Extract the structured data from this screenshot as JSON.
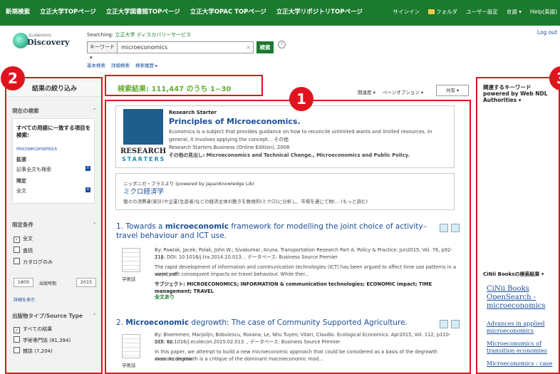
{
  "topbar": {
    "links": [
      "新規検索",
      "立正大学TOPページ",
      "立正大学図書館TOPページ",
      "立正大学OPAC TOPページ",
      "立正大学リポジトリTOPページ"
    ],
    "sign_in": "サインイン",
    "folder": "フォルダ",
    "user_settings": "ユーザー設定",
    "language": "言語 ▾",
    "help": "Help(英語)"
  },
  "header": {
    "logo_small": "国立情報学研究所",
    "logo_word": "Discovery",
    "searching_label": "Searching:",
    "searching_value": "立正大学 ディスカバリーサービス",
    "field_select": "キーワード ▾",
    "query": "microeconomics",
    "clear": "×",
    "search_button": "検索",
    "help": "?",
    "basic_search": "基本検索",
    "advanced_search": "詳細検索",
    "search_history": "検索履歴 ▸",
    "logout": "Log out"
  },
  "results": {
    "count_text": "検索結果: 111,447 のうち 1~30",
    "relevance": "関連度 ▾",
    "page_options": "ページオプション ▾",
    "share": "共有 ▾"
  },
  "left": {
    "title": "結果の絞り込み",
    "current_search": "現在の検索",
    "all_terms": "すべての用語に一致する項目を検索:",
    "term": "microeconomics",
    "expand": "拡張",
    "expand_item": "記事全文も検索",
    "limit": "限定",
    "limit_item": "全文",
    "limit_conditions": "限定条件",
    "cb_fulltext": "全文",
    "cb_peer": "査読",
    "cb_catalog": "カタログのみ",
    "year_from": "1800",
    "year_label": "出版時期",
    "year_to": "2015",
    "show_more": "詳細を表示",
    "source_type": "出版物タイプ/Source Type",
    "cb_all": "すべての結果",
    "cb_journals": "学術専門誌 (81,394)",
    "cb_magazines": "雑誌 (7,204)"
  },
  "starter": {
    "heading": "Research Starter",
    "title": "Principles of Microeconomics.",
    "desc": "Economics is a subject that provides guidance on how to reconcile unlimited wants and limited resources. In general, it involves applying the concept... その他",
    "source": "Research Starters Business (Online Edition), 2008",
    "also": "その他の見出し: Microeconomics and Technical Change., Microeconomics and Public Policy.",
    "logo_r": "RESEARCH",
    "logo_s": "STARTERS"
  },
  "japanknowledge": {
    "provider": "ニッポニカ・プラスより (powered by JapanKnowledge Lib)",
    "title": "ミクロ経済学",
    "desc": "個々の消費者(家計)や企業(生産者)などの経済主体の動きを数視的(ミクロ)に分析し、市場を通じて財(... (もっと読む)"
  },
  "result1": {
    "num": "1.",
    "title_pre": "Towards a ",
    "title_bold": "microeconomic",
    "title_post": " framework for modelling the joint choice of activity–travel behaviour and ICT use.",
    "type": "学術誌",
    "by": "By: Pawlak, Jacek; Polak, John W.; Sivakumar, Aruna. Transportation Research Part A: Policy & Practice. Jun2015, Vol. 76, p92-112.",
    "doi": "21p. DOI: 10.1016/j.tra.2014.10.013. , データベース: Business Source Premier",
    "abs1": "The rapid development of information and communication technologies (ICT) has been argued to affect time use patterns in a variety of",
    "abs2": "ways, with consequent impacts on travel behaviour. While ther...",
    "subjects": "サブジェクト: MICROECONOMICS; INFORMATION & communication technologies; ECONOMIC impact; TIME management; TRAVEL",
    "fulltext": "全文あり"
  },
  "result2": {
    "num": "2.",
    "title_bold": "Microeconomic",
    "title_post": " degrowth: The case of Community Supported Agriculture.",
    "type": "学術誌",
    "by": "By: Bloemmen, Marjolijn; Bobulescu, Roxana; Le, Nhu Tuyen; Vitari, Claudio. Ecological Economics. Apr2015, Vol. 112, p110-115. 6p.",
    "doi": "DOI: 10.1016/j.ecolecon.2015.02.013. , データベース: Business Source Premier",
    "abs1": "In this paper, we attempt to build a new microeconomic approach that could be considered as a basis of the degrowth macroeconomic",
    "abs2": "view. As degrowth is a critique of the dominant macroeconomic mod..."
  },
  "right": {
    "heading": "関連するキーワード powered by Web NDL Authorities ▾",
    "cinii": "CiNii Booksの検索結果 ▾",
    "link1": "CiNii Books",
    "link2": "OpenSearch -",
    "link3": "microeconomics",
    "link4": "Advances in applied",
    "link5": "microeconomics",
    "link6": "Microeconomics of",
    "link7": "transition economies",
    "link8": "Microeconomics : case"
  },
  "badges": [
    "1",
    "2",
    "3"
  ]
}
